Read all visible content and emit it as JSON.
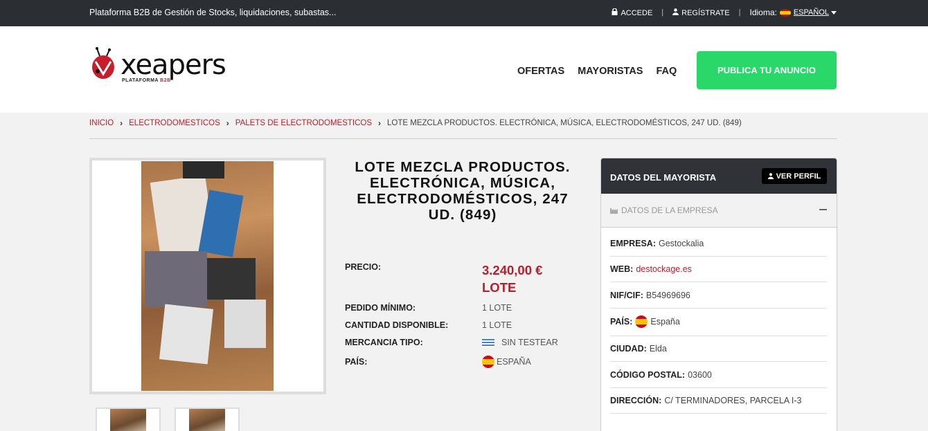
{
  "topbar": {
    "tagline": "Plataforma B2B de Gestión de Stocks, liquidaciones, subastas...",
    "login": "ACCEDE",
    "register": "REGÍSTRATE",
    "language_label": "Idioma:",
    "language_value": "ESPAÑOL"
  },
  "header": {
    "logo_text": "xeapers",
    "logo_sub_prefix": "PLATAFORMA",
    "logo_sub_suffix": "B2B",
    "nav": [
      "OFERTAS",
      "MAYORISTAS",
      "FAQ"
    ],
    "publish_button": "PUBLICA TU ANUNCIO"
  },
  "breadcrumb": {
    "items": [
      "INICIO",
      "ELECTRODOMESTICOS",
      "PALETS DE ELECTRODOMESTICOS"
    ],
    "current": "LOTE MEZCLA PRODUCTOS. ELECTRÓNICA, MÚSICA, ELECTRODOMÉSTICOS, 247 UD. (849)"
  },
  "product": {
    "title": "LOTE MEZCLA PRODUCTOS. ELECTRÓNICA, MÚSICA, ELECTRODOMÉSTICOS, 247 UD. (849)",
    "price_label": "PRECIO:",
    "price_value": "3.240,00 €",
    "price_unit": "LOTE",
    "min_order_label": "PEDIDO MÍNIMO:",
    "min_order_value": "1 LOTE",
    "available_label": "CANTIDAD DISPONIBLE:",
    "available_value": "1 LOTE",
    "type_label": "MERCANCIA TIPO:",
    "type_value": "SIN TESTEAR",
    "country_label": "PAÍS:",
    "country_value": "ESPAÑA"
  },
  "seller": {
    "header": "DATOS DEL MAYORISTA",
    "profile_button": "VER PERFIL",
    "section": "DATOS DE LA EMPRESA",
    "company_label": "EMPRESA:",
    "company_value": "Gestockalia",
    "web_label": "WEB:",
    "web_value": "destockage.es",
    "nif_label": "NIF/CIF:",
    "nif_value": "B54969696",
    "country_label": "PAÍS:",
    "country_value": "España",
    "city_label": "CIUDAD:",
    "city_value": "Elda",
    "postal_label": "CÓDIGO POSTAL:",
    "postal_value": "03600",
    "address_label": "DIRECCIÓN:",
    "address_value": "C/ TERMINADORES, PARCELA I-3"
  },
  "colors": {
    "accent_red": "#b5202d",
    "publish_green": "#2ad86a",
    "topbar_dark": "#2b2e33"
  }
}
